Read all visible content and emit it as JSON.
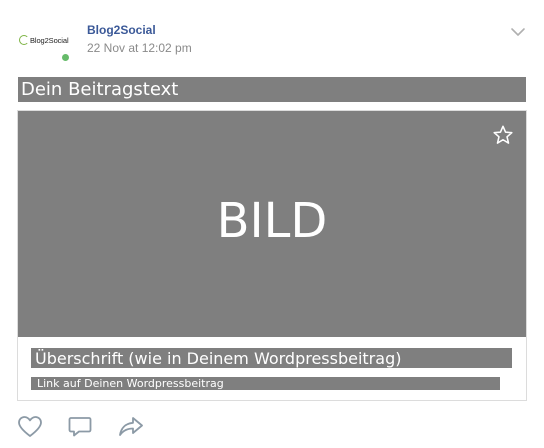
{
  "post": {
    "avatar_brand": "Blog2Social",
    "author": "Blog2Social",
    "timestamp": "22 Nov at 12:02 pm",
    "text": "Dein Beitragstext"
  },
  "card": {
    "image_label": "BILD",
    "title": "Überschrift (wie in Deinem Wordpressbeitrag)",
    "link": "Link auf Deinen Wordpressbeitrag"
  },
  "icons": {
    "menu": "chevron-down-icon",
    "bookmark": "star-icon",
    "like": "heart-icon",
    "comment": "comment-icon",
    "share": "share-icon"
  },
  "colors": {
    "placeholder_gray": "#7f7f7f",
    "author_blue": "#3b5998",
    "online_green": "#66bb6a",
    "icon_gray": "#8c9aa6"
  }
}
